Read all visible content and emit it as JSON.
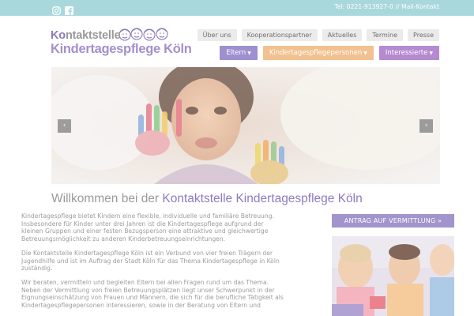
{
  "topbar": {
    "social_icons": [
      "instagram-icon",
      "facebook-icon"
    ],
    "contact": "Tel: 0221-913927-0 // Mail-Kontakt"
  },
  "logo": {
    "line1_prefix": "Ko",
    "line1_rest": "ntaktstelle",
    "line2": "Kindertagespflege Köln"
  },
  "nav_secondary": [
    "Über uns",
    "Kooperationspartner",
    "Aktuelles",
    "Termine",
    "Presse"
  ],
  "nav_primary": [
    {
      "label": "Eltern",
      "color": "#9e8fd0"
    },
    {
      "label": "Kindertagespflegepersonen",
      "color": "#f2c18f"
    },
    {
      "label": "Interessierte",
      "color": "#b58ad1"
    }
  ],
  "hero": {
    "prev_icon": "chevron-left-icon",
    "next_icon": "chevron-right-icon"
  },
  "welcome": {
    "prefix": "Willkommen bei der ",
    "highlight": "Kontaktstelle Kindertagespflege Köln"
  },
  "paragraphs": [
    "Kindertagespflege bietet Kindern eine flexible, individuelle und familiäre Betreuung. Insbesondere für Kinder unter drei Jahren ist die Kindertagespflege aufgrund der kleinen Gruppen und einer festen Bezugsperson eine attraktive und gleichwertige Betreuungsmöglichkeit zu anderen Kinderbetreuungseinrichtungen.",
    "Die Kontaktstelle Kindertagespflege Köln ist ein Verbund von vier freien Trägern der Jugendhilfe und ist im Auftrag der Stadt Köln für das Thema Kindertagespflege in Köln zuständig.",
    "Wir beraten, vermitteln und begleiten Eltern bei allen Fragen rund um das Thema. Neben der Vermittlung von freien Betreuungsplätzen liegt unser Schwerpunkt in der Eignungseinschätzung von Frauen und Männern, die sich für die berufliche Tätigkeit als Kindertagespflegepersonen interessieren, sowie in der Beratung von Eltern und"
  ],
  "sidebar": {
    "cta": "ANTRAG AUF VERMITTLUNG »"
  }
}
